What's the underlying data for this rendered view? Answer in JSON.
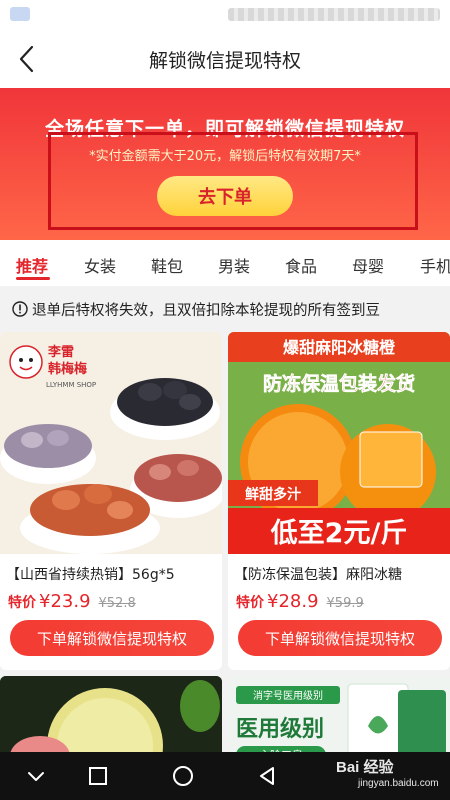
{
  "header": {
    "title": "解锁微信提现特权"
  },
  "banner": {
    "headline": "全场任意下一单，即可解锁微信提现特权",
    "note": "*实付金额需大于20元，解锁后特权有效期7天*",
    "button_label": "去下单"
  },
  "tabs": [
    {
      "label": "推荐",
      "active": true
    },
    {
      "label": "女装"
    },
    {
      "label": "鞋包"
    },
    {
      "label": "男装"
    },
    {
      "label": "食品"
    },
    {
      "label": "母婴"
    },
    {
      "label": "手机"
    }
  ],
  "notice": {
    "text": "退单后特权将失效，且双倍扣除本轮提现的所有签到豆"
  },
  "products": [
    {
      "title": "【山西省持续热销】56g*5",
      "price_label": "特价",
      "price": "¥23.9",
      "original_price": "¥52.8",
      "button_label": "下单解锁微信提现特权",
      "image_text": {
        "brand": "李雷",
        "brand2": "韩梅梅",
        "brand_sub": "LLYHMM SHOP"
      }
    },
    {
      "title": "【防冻保温包装】麻阳冰糖",
      "price_label": "特价",
      "price": "¥28.9",
      "original_price": "¥59.9",
      "button_label": "下单解锁微信提现特权",
      "image_text": {
        "top": "爆甜麻阳冰糖橙",
        "mid": "防冻保温包装发货",
        "tag": "鲜甜多汁",
        "bottom": "低至2元/斤"
      }
    }
  ],
  "products_row2": {
    "right_text": {
      "badge": "消字号医用级别",
      "headline": "医用级别",
      "line": "主除口臭"
    }
  },
  "watermark": {
    "main": "Bai 经验",
    "sub": "jingyan.baidu.com"
  },
  "colors": {
    "accent": "#e4252b",
    "banner_top": "#f0353a",
    "button_yellow": "#ffd23a"
  }
}
